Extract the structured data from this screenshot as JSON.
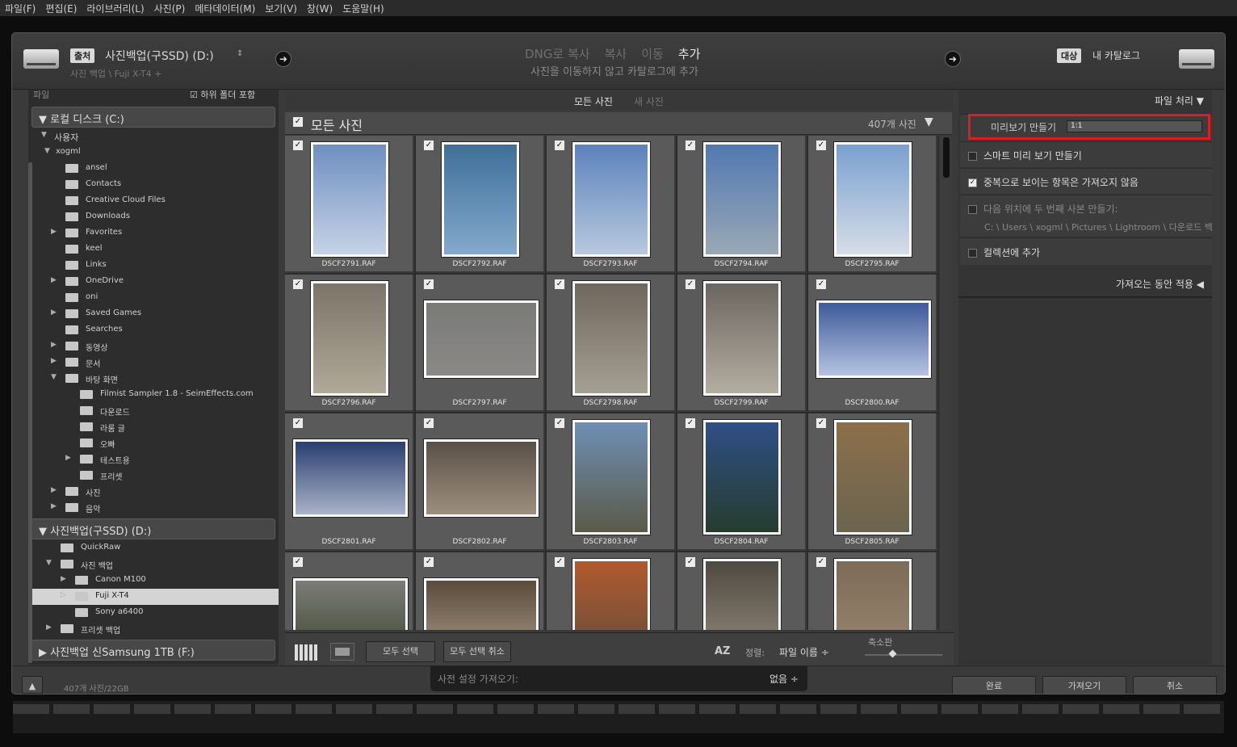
{
  "menu": [
    "파일(F)",
    "편집(E)",
    "라이브러리(L)",
    "사진(P)",
    "메타데이터(M)",
    "보기(V)",
    "창(W)",
    "도움말(H)"
  ],
  "source": {
    "tag": "출처",
    "name": "사진백업(구SSD) (D:)",
    "path": "사진 백업 \\ Fuji X-T4 +"
  },
  "modes": [
    "DNG로 복사",
    "복사",
    "이동",
    "추가"
  ],
  "mode_desc": "사진을 이동하지 않고 카탈로그에 추가",
  "dest": {
    "tag": "대상",
    "name": "내 카탈로그"
  },
  "left": {
    "files_label": "파일",
    "include_sub": "하위 폴더 포함",
    "local_disk": "로컬 디스크 (C:)",
    "users": "사용자",
    "user": "xogml",
    "folders": [
      "ansel",
      "Contacts",
      "Creative Cloud Files",
      "Downloads",
      "Favorites",
      "keel",
      "Links",
      "OneDrive",
      "oni",
      "Saved Games",
      "Searches",
      "동영상",
      "문서",
      "바탕 화면"
    ],
    "desktop_sub": [
      "Filmist Sampler 1.8 - SeimEffects.com",
      "다운로드",
      "라룸 글",
      "오빠",
      "테스트용",
      "프리셋"
    ],
    "after": [
      "사진",
      "음악"
    ],
    "drive_d": "사진백업(구SSD) (D:)",
    "d_items": [
      "QuickRaw",
      "사진 백업"
    ],
    "d_sub": [
      "Canon M100",
      "Fuji X-T4",
      "Sony a6400"
    ],
    "d_after": "프리셋 백업",
    "drive_f": "사진백업 신Samsung 1TB (F:)"
  },
  "center": {
    "tabs": [
      "모든 사진",
      "새 사진"
    ],
    "grid_title": "모든 사진",
    "count": "407개 사진",
    "files": [
      "DSCF2791.RAF",
      "DSCF2792.RAF",
      "DSCF2793.RAF",
      "DSCF2794.RAF",
      "DSCF2795.RAF",
      "DSCF2796.RAF",
      "DSCF2797.RAF",
      "DSCF2798.RAF",
      "DSCF2799.RAF",
      "DSCF2800.RAF",
      "DSCF2801.RAF",
      "DSCF2802.RAF",
      "DSCF2803.RAF",
      "DSCF2804.RAF",
      "DSCF2805.RAF",
      "",
      "",
      "",
      "",
      ""
    ],
    "select_all": "모두 선택",
    "deselect_all": "모두 선택 취소",
    "sort_label": "정렬:",
    "sort_value": "파일 이름 ÷",
    "thumb_label": "축소판"
  },
  "right": {
    "file_handling": "파일 처리",
    "preview_label": "미리보기 만들기",
    "preview_value": "1:1",
    "smart_preview": "스마트 미리 보기 만들기",
    "no_duplicates": "중복으로 보이는 항목은 가져오지 않음",
    "second_copy": "다음 위치에 두 번째 사본 만들기:",
    "second_path": "C: \\ Users \\ xogml \\ Pictures \\ Lightroom \\ 다운로드 백",
    "add_collection": "컬렉션에 추가",
    "apply_during": "가져오는 동안 적용"
  },
  "bottom": {
    "stats": "407개 사진/22GB",
    "preset_label": "사전 설정 가져오기:",
    "preset_value": "없음 ÷",
    "done": "완료",
    "import": "가져오기",
    "cancel": "취소"
  },
  "colors": {
    "highlight": "#e01b22",
    "selected_row": "#d4d4d4"
  }
}
